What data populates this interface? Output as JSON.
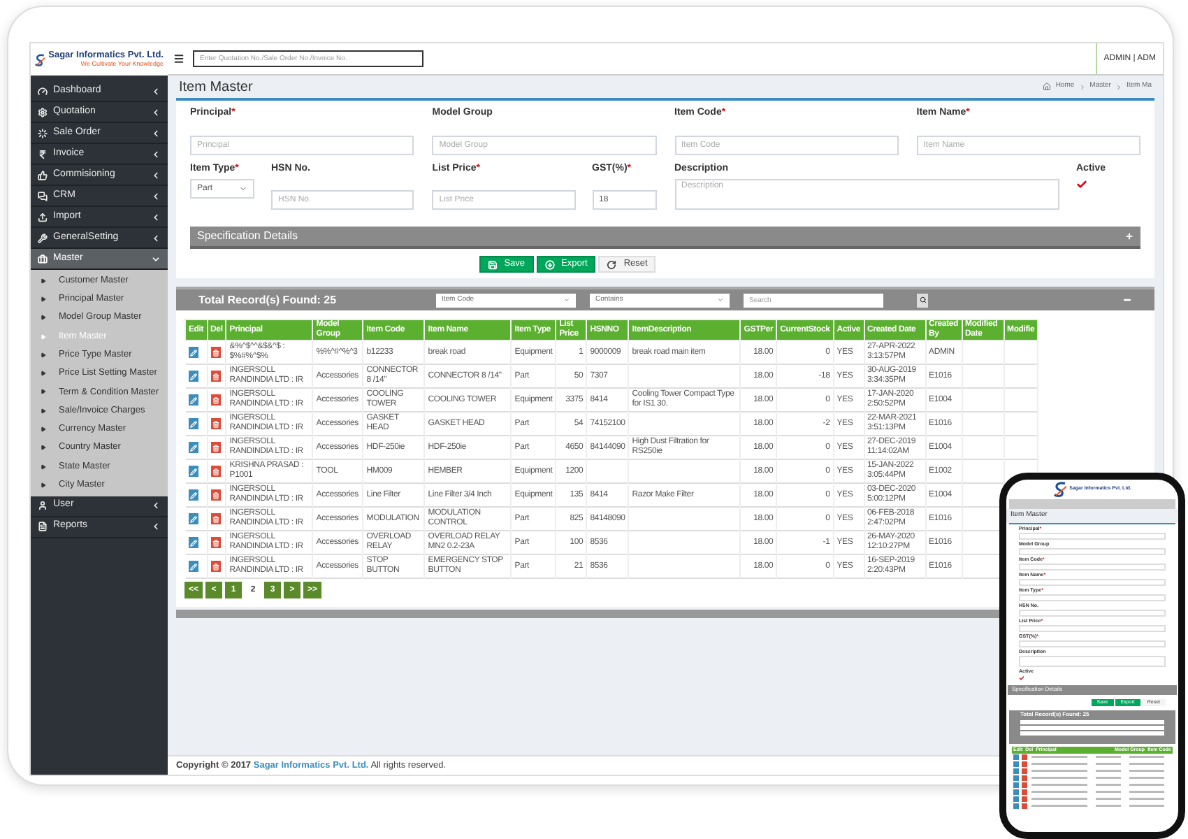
{
  "logo": {
    "name": "Sagar Informatics Pvt. Ltd.",
    "tagline": "We Cultivate Your Knowledge"
  },
  "header": {
    "search_placeholder": "Enter Quotation No./Sale Order No./Invoice No.",
    "user": "ADMIN | ADM"
  },
  "sidebar": {
    "items": [
      {
        "label": "Dashboard",
        "expanded": false,
        "selected": false
      },
      {
        "label": "Quotation",
        "expanded": false,
        "selected": false
      },
      {
        "label": "Sale Order",
        "expanded": false,
        "selected": false
      },
      {
        "label": "Invoice",
        "expanded": false,
        "selected": false
      },
      {
        "label": "Commisioning",
        "expanded": false,
        "selected": false
      },
      {
        "label": "CRM",
        "expanded": false,
        "selected": false
      },
      {
        "label": "Import",
        "expanded": false,
        "selected": false
      },
      {
        "label": "GeneralSetting",
        "expanded": false,
        "selected": false
      },
      {
        "label": "Master",
        "expanded": true,
        "selected": true,
        "children": [
          {
            "label": "Customer Master",
            "selected": false
          },
          {
            "label": "Principal Master",
            "selected": false
          },
          {
            "label": "Model Group Master",
            "selected": false
          },
          {
            "label": "Item Master",
            "selected": true
          },
          {
            "label": "Price Type Master",
            "selected": false
          },
          {
            "label": "Price List Setting Master",
            "selected": false
          },
          {
            "label": "Term & Condition Master",
            "selected": false
          },
          {
            "label": "Sale/Invoice Charges",
            "selected": false
          },
          {
            "label": "Currency Master",
            "selected": false
          },
          {
            "label": "Country Master",
            "selected": false
          },
          {
            "label": "State Master",
            "selected": false
          },
          {
            "label": "City Master",
            "selected": false
          }
        ]
      },
      {
        "label": "User",
        "expanded": false,
        "selected": false
      },
      {
        "label": "Reports",
        "expanded": false,
        "selected": false
      }
    ]
  },
  "page": {
    "title": "Item Master",
    "breadcrumb": [
      "Home",
      "Master",
      "Item Ma"
    ]
  },
  "form": {
    "principal": {
      "label": "Principal",
      "mark": "*",
      "placeholder": "Principal"
    },
    "model_group": {
      "label": "Model Group",
      "placeholder": "Model Group"
    },
    "item_code": {
      "label": "Item Code",
      "mark": "*",
      "placeholder": "Item Code"
    },
    "item_name": {
      "label": "Item Name",
      "mark": "*",
      "placeholder": "Item Name"
    },
    "item_type": {
      "label": "Item Type",
      "mark": "*",
      "value": "Part"
    },
    "hsn_no": {
      "label": "HSN No.",
      "placeholder": "HSN No."
    },
    "list_price": {
      "label": "List Price",
      "mark": "*",
      "placeholder": "List Price"
    },
    "gst": {
      "label": "GST(%)",
      "mark": "*",
      "value": "18"
    },
    "description": {
      "label": "Description",
      "placeholder": "Description"
    },
    "active": {
      "label": "Active",
      "checked": true
    }
  },
  "specification": {
    "title": "Specification Details",
    "expanded": false
  },
  "actions": [
    {
      "label": "Save",
      "kind": "primary"
    },
    {
      "label": "Export",
      "kind": "primary"
    },
    {
      "label": "Reset",
      "kind": "plain"
    }
  ],
  "records": {
    "title": "Total Record(s) Found: 25",
    "field_filter": "Item Code",
    "match_filter": "Contains",
    "search_placeholder": "Search"
  },
  "table": {
    "columns": [
      "Edit",
      "Del",
      "Principal",
      "Model Group",
      "Item Code",
      "Item Name",
      "Item Type",
      "List Price",
      "HSNNO",
      "ItemDescription",
      "GSTPer",
      "CurrentStock",
      "Active",
      "Created Date",
      "Created By",
      "Modified Date",
      "Modifie"
    ],
    "rows": [
      {
        "cells": [
          "",
          "",
          "&%^$^^&$&^$ : $%#%^$%",
          "%%^#^%^3",
          "b12233",
          "break road",
          "Equipment",
          "1",
          "9000009",
          "break road main item",
          "18.00",
          "0",
          "YES",
          "27-APR-2022 3:13:57PM",
          "ADMIN"
        ]
      },
      {
        "cells": [
          "",
          "",
          "INGERSOLL RANDINDIA LTD : IR",
          "Accessories",
          "CONNECTOR 8 /14\"",
          "CONNECTOR 8 /14\"",
          "Part",
          "50",
          "7307",
          null,
          "18.00",
          "-18",
          "YES",
          "30-AUG-2019 3:34:35PM",
          "E1016"
        ]
      },
      {
        "cells": [
          "",
          "",
          "INGERSOLL RANDINDIA LTD : IR",
          "Accessories",
          "COOLING TOWER",
          "COOLING TOWER",
          "Equipment",
          "3375",
          "8414",
          "Cooling Tower Compact Type for IS1 30.",
          "18.00",
          "0",
          "YES",
          "17-JAN-2020 2:50:52PM",
          "E1004"
        ]
      },
      {
        "cells": [
          "",
          "",
          "INGERSOLL RANDINDIA LTD : IR",
          "Accessories",
          "GASKET HEAD",
          "GASKET HEAD",
          "Part",
          "54",
          "74152100",
          null,
          "18.00",
          "-2",
          "YES",
          "22-MAR-2021 3:51:13PM",
          "E1016"
        ]
      },
      {
        "cells": [
          "",
          "",
          "INGERSOLL RANDINDIA LTD : IR",
          "Accessories",
          "HDF-250ie",
          "HDF-250ie",
          "Part",
          "4650",
          "84144090",
          "High Dust Filtration for RS250ie",
          "18.00",
          "0",
          "YES",
          "27-DEC-2019 11:14:02AM",
          "E1004"
        ]
      },
      {
        "cells": [
          "",
          "",
          "KRISHNA PRASAD : P1001",
          "TOOL",
          "HM009",
          "HEMBER",
          "Equipment",
          "1200",
          null,
          null,
          "18.00",
          "0",
          "YES",
          "15-JAN-2022 3:05:44PM",
          "E1002"
        ]
      },
      {
        "cells": [
          "",
          "",
          "INGERSOLL RANDINDIA LTD : IR",
          "Accessories",
          "Line Filter",
          "Line Filter 3/4 Inch",
          "Equipment",
          "135",
          "8414",
          "Razor Make Filter",
          "18.00",
          "0",
          "YES",
          "03-DEC-2020 5:00:12PM",
          "E1004"
        ]
      },
      {
        "cells": [
          "",
          "",
          "INGERSOLL RANDINDIA LTD : IR",
          "Accessories",
          "MODULATION",
          "MODULATION CONTROL",
          "Part",
          "825",
          "84148090",
          null,
          "18.00",
          "0",
          "YES",
          "06-FEB-2018 2:47:02PM",
          "E1016"
        ]
      },
      {
        "cells": [
          "",
          "",
          "INGERSOLL RANDINDIA LTD : IR",
          "Accessories",
          "OVERLOAD RELAY",
          "OVERLOAD RELAY MN2 0.2-23A",
          "Part",
          "100",
          "8536",
          null,
          "18.00",
          "-1",
          "YES",
          "26-MAY-2020 12:10:27PM",
          "E1016"
        ]
      },
      {
        "cells": [
          "",
          "",
          "INGERSOLL RANDINDIA LTD : IR",
          "Accessories",
          "STOP BUTTON",
          "EMERGENCY STOP BUTTON",
          "Part",
          "21",
          "8536",
          null,
          "18.00",
          "0",
          "YES",
          "16-SEP-2019 2:20:43PM",
          "E1016"
        ]
      }
    ]
  },
  "pagination": [
    {
      "label": "<<",
      "selected": false
    },
    {
      "label": "<",
      "selected": false
    },
    {
      "label": "1",
      "selected": false
    },
    {
      "label": "2",
      "selected": true
    },
    {
      "label": "3",
      "selected": false
    },
    {
      "label": ">",
      "selected": false
    },
    {
      "label": ">>",
      "selected": false
    }
  ],
  "footer": {
    "prefix": "Copyright © 2017",
    "link": "Sagar Informatics Pvt. Ltd.",
    "suffix": "All rights reserved."
  },
  "phone": {
    "brand": "Sagar Informatics Pvt. Ltd.",
    "title": "Item Master",
    "fields": [
      {
        "label": "Principal",
        "mark": "*",
        "kind": "input"
      },
      {
        "label": "Model Group",
        "kind": "input"
      },
      {
        "label": "Item Code",
        "mark": "*",
        "kind": "input"
      },
      {
        "label": "Item Name",
        "mark": "*",
        "kind": "input"
      },
      {
        "label": "Item Type",
        "mark": "*",
        "kind": "select"
      },
      {
        "label": "HSN No.",
        "kind": "input"
      },
      {
        "label": "List Price",
        "mark": "*",
        "kind": "input"
      },
      {
        "label": "GST(%)",
        "mark": "*",
        "kind": "input"
      },
      {
        "label": "Description",
        "kind": "textarea"
      },
      {
        "label": "Active",
        "kind": "checkbox",
        "checked": true
      }
    ],
    "section": "Specification Details",
    "buttons": [
      {
        "label": "Save",
        "kind": "primary"
      },
      {
        "label": "Export",
        "kind": "primary"
      },
      {
        "label": "Reset",
        "kind": "plain"
      }
    ],
    "records_title": "Total Record(s) Found: 25",
    "columns": [
      "Edit",
      "Del",
      "Principal",
      "Model Group",
      "Item Code"
    ]
  }
}
